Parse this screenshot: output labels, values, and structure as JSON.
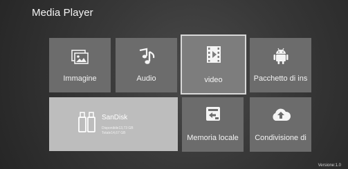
{
  "header": {
    "title": "Media Player"
  },
  "tiles": [
    {
      "label": "Immagine",
      "icon": "image-icon"
    },
    {
      "label": "Audio",
      "icon": "music-notes-icon"
    },
    {
      "label": "video",
      "icon": "video-film-icon",
      "selected": true
    },
    {
      "label": "Pacchetto di ins",
      "icon": "android-icon"
    },
    {
      "label": "Memoria locale",
      "icon": "local-storage-icon"
    },
    {
      "label": "Condivisione di",
      "icon": "cloud-upload-icon"
    }
  ],
  "usb_device": {
    "name": "SanDisk",
    "available": "Disponibile13,73 GB",
    "total": "Totale14,67 GB",
    "icon": "usb-drive-icon"
  },
  "footer": {
    "version": "Versione:1.0"
  },
  "colors": {
    "tile_default": "#6c6c6c",
    "tile_selected": "#7d7d7d",
    "tile_usb": "#bdbdbd",
    "selected_border": "#d9d9d9"
  }
}
